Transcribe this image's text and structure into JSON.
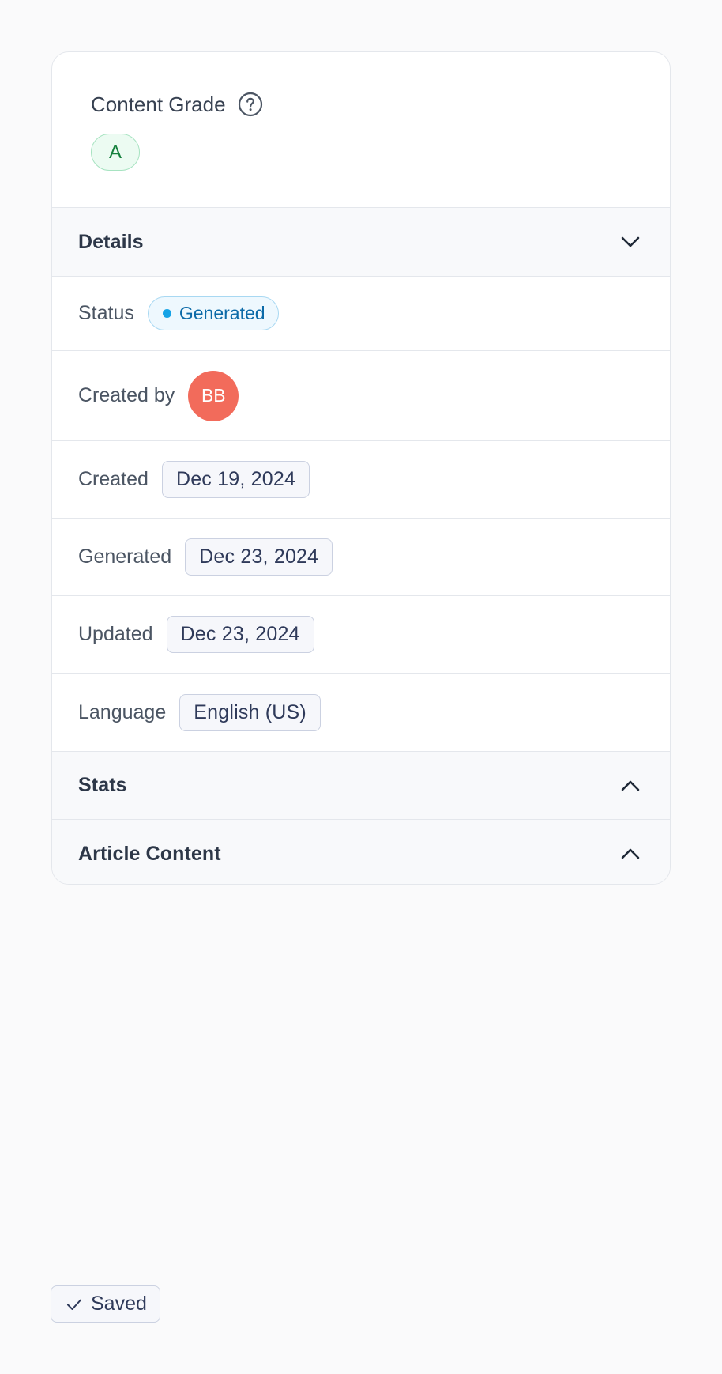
{
  "content_grade": {
    "title": "Content Grade",
    "help_icon": "question-circle-icon",
    "grade": "A"
  },
  "details": {
    "header_label": "Details",
    "chevron_icon": "chevron-down-icon",
    "status": {
      "label": "Status",
      "value": "Generated",
      "dot_color": "#16a3e6"
    },
    "created_by": {
      "label": "Created by",
      "initials": "BB",
      "avatar_color": "#f26b5b"
    },
    "created": {
      "label": "Created",
      "value": "Dec 19, 2024"
    },
    "generated": {
      "label": "Generated",
      "value": "Dec 23, 2024"
    },
    "updated": {
      "label": "Updated",
      "value": "Dec 23, 2024"
    },
    "language": {
      "label": "Language",
      "value": "English (US)"
    }
  },
  "stats": {
    "header_label": "Stats",
    "chevron_icon": "chevron-up-icon"
  },
  "article_content": {
    "header_label": "Article Content",
    "chevron_icon": "chevron-up-icon"
  },
  "save_status": {
    "label": "Saved",
    "icon": "check-icon"
  }
}
